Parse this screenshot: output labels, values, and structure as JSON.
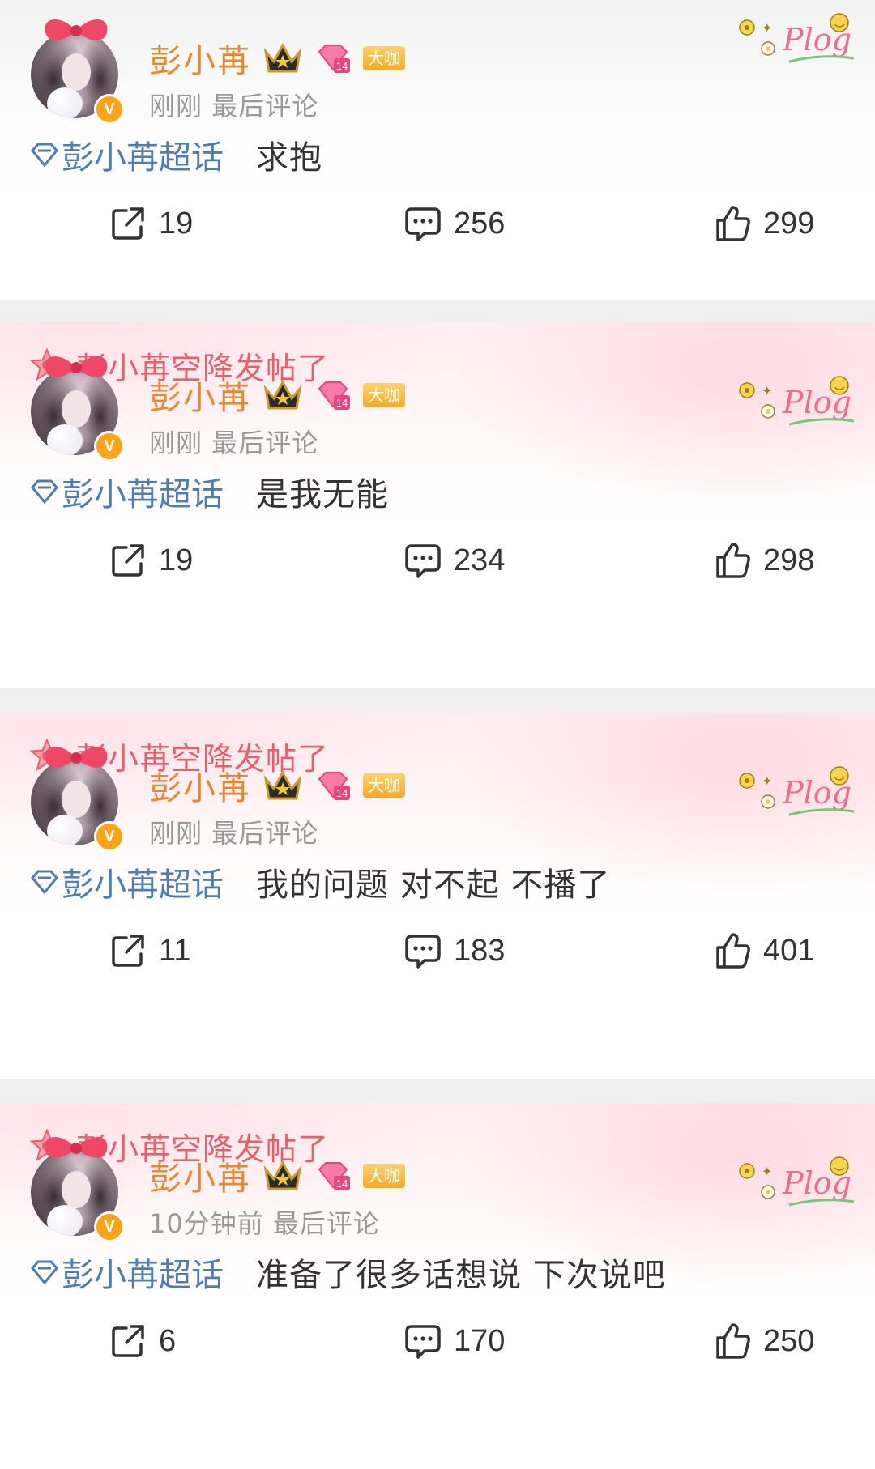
{
  "posts": [
    {
      "banner": "",
      "username": "彭小苒",
      "level_badge": "大咖",
      "avatar_badge": "V",
      "time": "刚刚",
      "meta_suffix": "最后评论",
      "topic": "彭小苒超话",
      "text": "求抱",
      "shares": "19",
      "comments": "256",
      "likes": "299"
    },
    {
      "banner": "彭小苒空降发帖了",
      "username": "彭小苒",
      "level_badge": "大咖",
      "avatar_badge": "V",
      "time": "刚刚",
      "meta_suffix": "最后评论",
      "topic": "彭小苒超话",
      "text": "是我无能",
      "shares": "19",
      "comments": "234",
      "likes": "298"
    },
    {
      "banner": "彭小苒空降发帖了",
      "username": "彭小苒",
      "level_badge": "大咖",
      "avatar_badge": "V",
      "time": "刚刚",
      "meta_suffix": "最后评论",
      "topic": "彭小苒超话",
      "text": "我的问题 对不起 不播了",
      "shares": "11",
      "comments": "183",
      "likes": "401"
    },
    {
      "banner": "彭小苒空降发帖了",
      "username": "彭小苒",
      "level_badge": "大咖",
      "avatar_badge": "V",
      "time": "10分钟前",
      "meta_suffix": "最后评论",
      "topic": "彭小苒超话",
      "text": "准备了很多话想说 下次说吧",
      "shares": "6",
      "comments": "170",
      "likes": "250"
    }
  ],
  "sticker_text": "Plog",
  "icons": {
    "share": "share-icon",
    "comment": "comment-icon",
    "like": "thumbs-up-icon",
    "topic": "super-topic-diamond-icon",
    "crown": "crown-icon",
    "diamond": "diamond-icon",
    "banner": "star-icon"
  },
  "colors": {
    "username": "#e8872e",
    "topic": "#507daf",
    "banner": "#e6606c",
    "meta": "#999999"
  }
}
